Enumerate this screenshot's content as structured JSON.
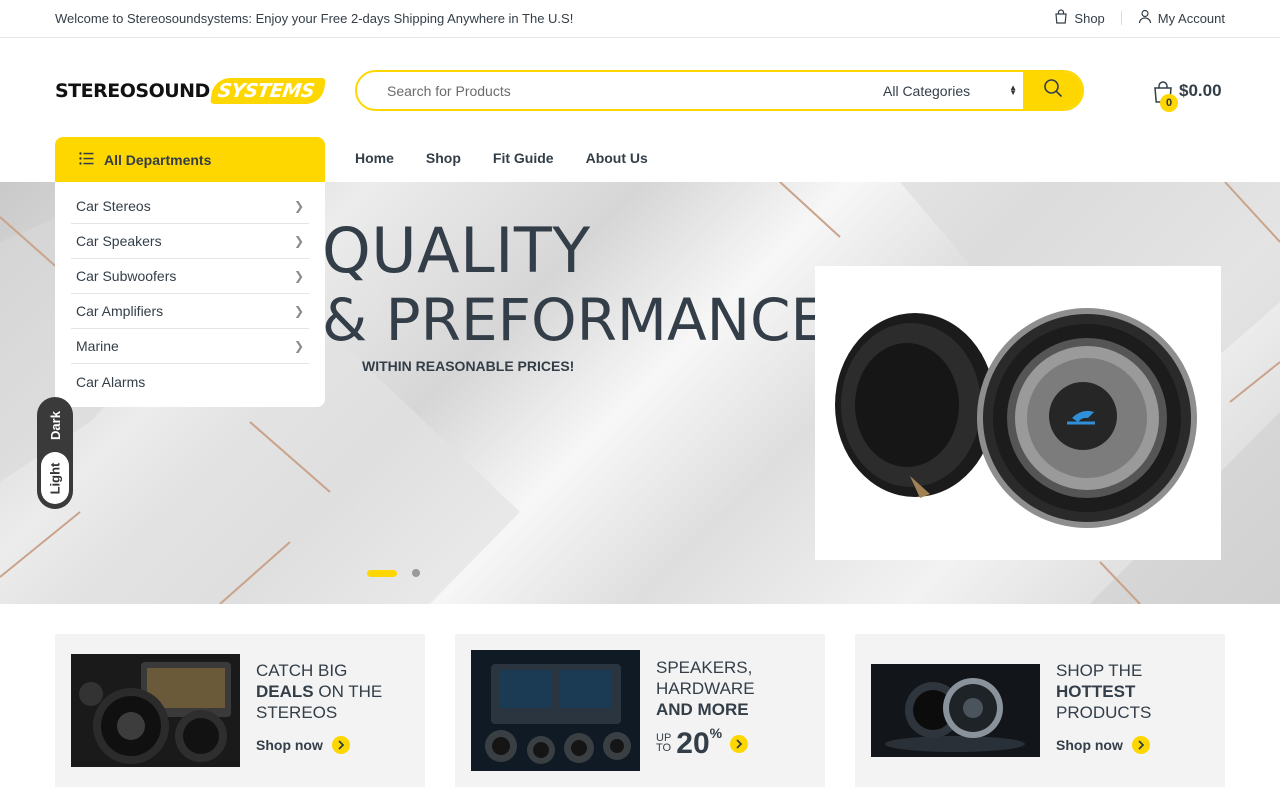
{
  "topbar": {
    "welcome": "Welcome to Stereosoundsystems: Enjoy your Free 2-days Shipping Anywhere in The U.S!",
    "links": [
      {
        "label": "Shop",
        "icon": "shopping-bag-icon"
      },
      {
        "label": "My Account",
        "icon": "user-icon"
      }
    ]
  },
  "logo": {
    "part1": "STEREOSOUND",
    "part2": "SYSTEMS"
  },
  "search": {
    "placeholder": "Search for Products",
    "category": "All Categories"
  },
  "cart": {
    "count": "0",
    "total": "$0.00"
  },
  "nav": {
    "departments_label": "All Departments",
    "links": [
      "Home",
      "Shop",
      "Fit Guide",
      "About Us"
    ]
  },
  "departments": [
    {
      "label": "Car Stereos",
      "has_sub": true
    },
    {
      "label": "Car Speakers",
      "has_sub": true
    },
    {
      "label": "Car Subwoofers",
      "has_sub": true
    },
    {
      "label": "Car Amplifiers",
      "has_sub": true
    },
    {
      "label": "Marine",
      "has_sub": true
    },
    {
      "label": "Car Alarms",
      "has_sub": false
    }
  ],
  "theme_toggle": {
    "dark": "Dark",
    "light": "Light"
  },
  "hero": {
    "line1": "QUALITY",
    "line2": "& PREFORMANCE",
    "subtitle": "WITHIN REASONABLE PRICES!",
    "slides": 2,
    "active_slide": 1
  },
  "promos": [
    {
      "line1": "CATCH BIG",
      "bold": "DEALS",
      "rest": " ON THE",
      "line3": "STEREOS",
      "cta": "Shop now"
    },
    {
      "line1": "SPEAKERS,",
      "line2": "HARDWARE",
      "bold": "AND MORE",
      "upto": [
        "UP",
        "TO"
      ],
      "number": "20",
      "percent": "%"
    },
    {
      "line1": "SHOP THE",
      "bold": "HOTTEST",
      "line3": "PRODUCTS",
      "cta": "Shop now"
    }
  ],
  "colors": {
    "accent": "#fed700",
    "text": "#333e48"
  }
}
